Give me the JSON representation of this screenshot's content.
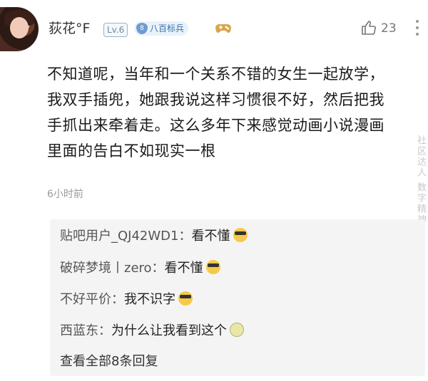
{
  "header": {
    "username": "荻花°F",
    "level": "Lv.6",
    "rank_title": "八百标兵",
    "like_count": "23"
  },
  "post": {
    "lines": [
      "不知道呢，当年和一个关系不错的女生一起放学，",
      "我双手插兜，她跟我说这样习惯很不好，然后把我",
      "手抓出来牵着走。这么多年下来感觉动画小说漫画",
      "里面的告白不如现实一根"
    ],
    "time": "6小时前"
  },
  "watermark": "社区达人 数字精神",
  "replies": [
    {
      "name": "贴吧用户_QJ42WD1",
      "sep": "：",
      "content": "看不懂",
      "emoji": "cool-emoji"
    },
    {
      "name": "破碎梦境丨zero",
      "sep": "：",
      "content": "看不懂",
      "emoji": "cool-emoji"
    },
    {
      "name": "不好平价",
      "sep": "：",
      "content": "我不识字",
      "emoji": "cool-emoji"
    },
    {
      "name": "西蓝东",
      "sep": "：",
      "content": "为什么让我看到这个",
      "emoji": "bun-emoji"
    }
  ],
  "view_all": "查看全部8条回复",
  "colors": {
    "badge_blue": "#3d6fa6",
    "reply_bg": "#f4f4f4",
    "meta_gray": "#9a9a9a"
  }
}
